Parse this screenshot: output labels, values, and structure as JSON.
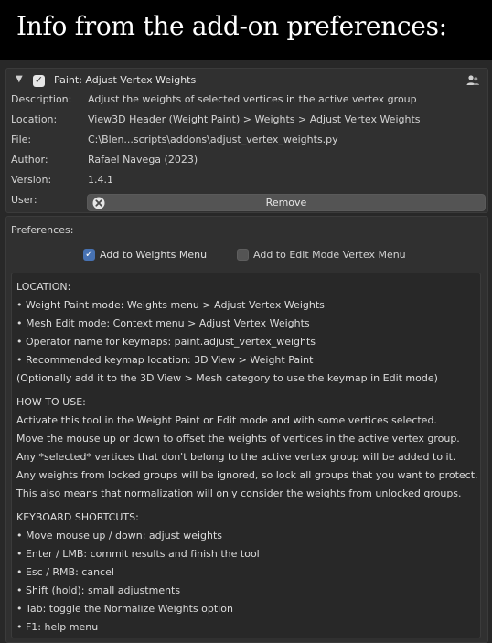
{
  "banner": {
    "title": "Info from the add-on preferences:"
  },
  "addon": {
    "name": "Paint: Adjust Vertex Weights",
    "enabled": true,
    "fields": [
      {
        "key": "Description:",
        "value": "Adjust the weights of selected vertices in the active vertex group"
      },
      {
        "key": "Location:",
        "value": "View3D Header (Weight Paint) > Weights > Adjust Vertex Weights"
      },
      {
        "key": "File:",
        "value": "C:\\Blen...scripts\\addons\\adjust_vertex_weights.py"
      },
      {
        "key": "Author:",
        "value": "Rafael Navega (2023)"
      },
      {
        "key": "Version:",
        "value": "1.4.1"
      }
    ],
    "user_key": "User:",
    "remove_label": "Remove"
  },
  "preferences": {
    "label": "Preferences:",
    "options": [
      {
        "label": "Add to Weights Menu",
        "checked": true
      },
      {
        "label": "Add to Edit Mode Vertex Menu",
        "checked": false
      }
    ],
    "lines": [
      "LOCATION:",
      "• Weight Paint mode: Weights menu > Adjust Vertex Weights",
      "• Mesh Edit mode: Context menu > Adjust Vertex Weights",
      "• Operator name for keymaps: paint.adjust_vertex_weights",
      "• Recommended keymap location: 3D View > Weight Paint",
      "(Optionally add it to the 3D View > Mesh category to use the keymap in Edit mode)",
      "HOW TO USE:",
      "Activate this tool in the Weight Paint or Edit mode and with some vertices selected.",
      "Move the mouse up or down to offset the weights of vertices in the active vertex group.",
      "Any *selected* vertices that don't belong to the active vertex group will be added to it.",
      "Any weights from locked groups will be ignored, so lock all groups that you want to protect.",
      "This also means that normalization will only consider the weights from unlocked groups.",
      "KEYBOARD SHORTCUTS:",
      "• Move mouse up / down: adjust weights",
      "• Enter / LMB: commit results and finish the tool",
      "• Esc / RMB: cancel",
      "• Shift (hold): small adjustments",
      "• Tab: toggle the Normalize Weights option",
      "• F1: help menu"
    ]
  },
  "icons": {
    "disclosure": "disclosure-triangle-icon",
    "users": "users-icon",
    "remove": "remove-x-icon",
    "checkbox": "checkbox-icon"
  },
  "colors": {
    "accent": "#4772b3",
    "panel": "#303030",
    "background": "#282828"
  }
}
